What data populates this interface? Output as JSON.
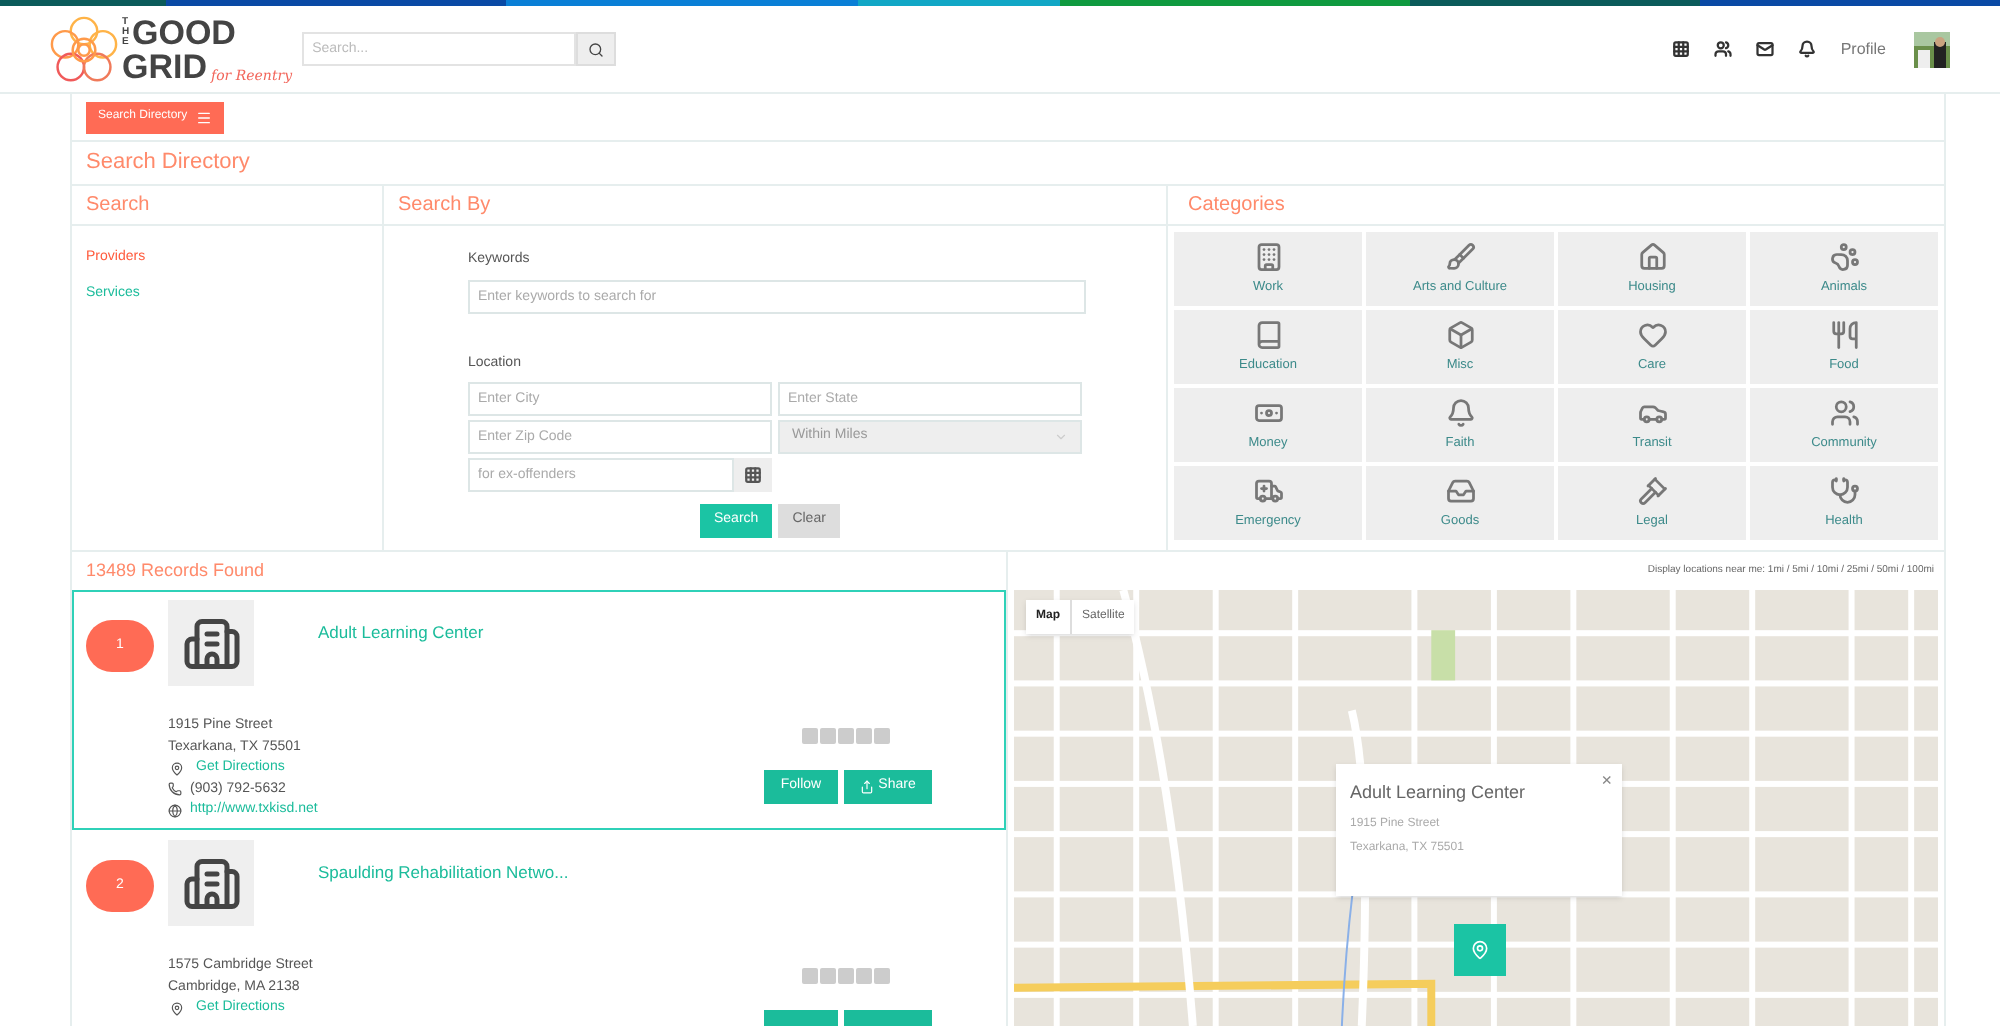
{
  "header": {
    "logo": {
      "line_1": "THE",
      "line_2": "GOOD",
      "line_3": "GRID",
      "tagline": "for Reentry"
    },
    "search": {
      "placeholder": "Search..."
    },
    "profile_label": "Profile"
  },
  "toolbar": {
    "menu_button": "Search Directory"
  },
  "page_title": "Search Directory",
  "search_panel": {
    "title": "Search",
    "items": [
      {
        "label": "Providers",
        "selected": true
      },
      {
        "label": "Services",
        "selected": false
      }
    ]
  },
  "search_by": {
    "title": "Search By",
    "keywords_label": "Keywords",
    "keywords": {
      "placeholder": "Enter keywords to search for"
    },
    "location_label": "Location",
    "city": {
      "placeholder": "Enter City"
    },
    "state": {
      "placeholder": "Enter State"
    },
    "zip": {
      "placeholder": "Enter Zip Code"
    },
    "miles": {
      "placeholder": "Within Miles",
      "disabled": true
    },
    "filter": {
      "placeholder": "for ex-offenders"
    },
    "buttons": [
      {
        "label": "Search",
        "kind": "primary"
      },
      {
        "label": "Clear",
        "kind": "secondary"
      }
    ]
  },
  "categories": {
    "title": "Categories",
    "items": [
      {
        "label": "Work",
        "kind": "building"
      },
      {
        "label": "Arts and Culture",
        "kind": "brush"
      },
      {
        "label": "Housing",
        "kind": "house"
      },
      {
        "label": "Animals",
        "kind": "paw"
      },
      {
        "label": "Education",
        "kind": "book"
      },
      {
        "label": "Misc",
        "kind": "box"
      },
      {
        "label": "Care",
        "kind": "heart"
      },
      {
        "label": "Food",
        "kind": "utensils"
      },
      {
        "label": "Money",
        "kind": "banknote"
      },
      {
        "label": "Faith",
        "kind": "bell"
      },
      {
        "label": "Transit",
        "kind": "car"
      },
      {
        "label": "Community",
        "kind": "users"
      },
      {
        "label": "Emergency",
        "kind": "ambulance"
      },
      {
        "label": "Goods",
        "kind": "inbox"
      },
      {
        "label": "Legal",
        "kind": "gavel"
      },
      {
        "label": "Health",
        "kind": "stethoscope"
      }
    ]
  },
  "results": {
    "count": "13489 Records Found",
    "distance_note": "Display locations near me: 1mi / 5mi / 10mi / 25mi / 50mi / 100mi",
    "records": [
      {
        "number": "1",
        "name": "Adult Learning Center",
        "address_1": "1915 Pine Street",
        "address_2": "Texarkana, TX 75501",
        "directions": "Get Directions",
        "phone": "(903) 792-5632",
        "website": "http://www.txkisd.net",
        "stars": 0,
        "selected": true,
        "follow": "Follow",
        "share": "Share"
      },
      {
        "number": "2",
        "name": "Spaulding Rehabilitation Netwo...",
        "address_1": "1575 Cambridge Street",
        "address_2": "Cambridge, MA 2138",
        "directions": "Get Directions",
        "stars": 0,
        "selected": false
      }
    ]
  },
  "map": {
    "types": [
      {
        "label": "Map",
        "selected": true
      },
      {
        "label": "Satellite",
        "selected": false
      }
    ],
    "info_window": {
      "title": "Adult Learning Center",
      "line_1": "1915 Pine Street",
      "line_2": "Texarkana, TX 75501",
      "close": "×"
    }
  }
}
